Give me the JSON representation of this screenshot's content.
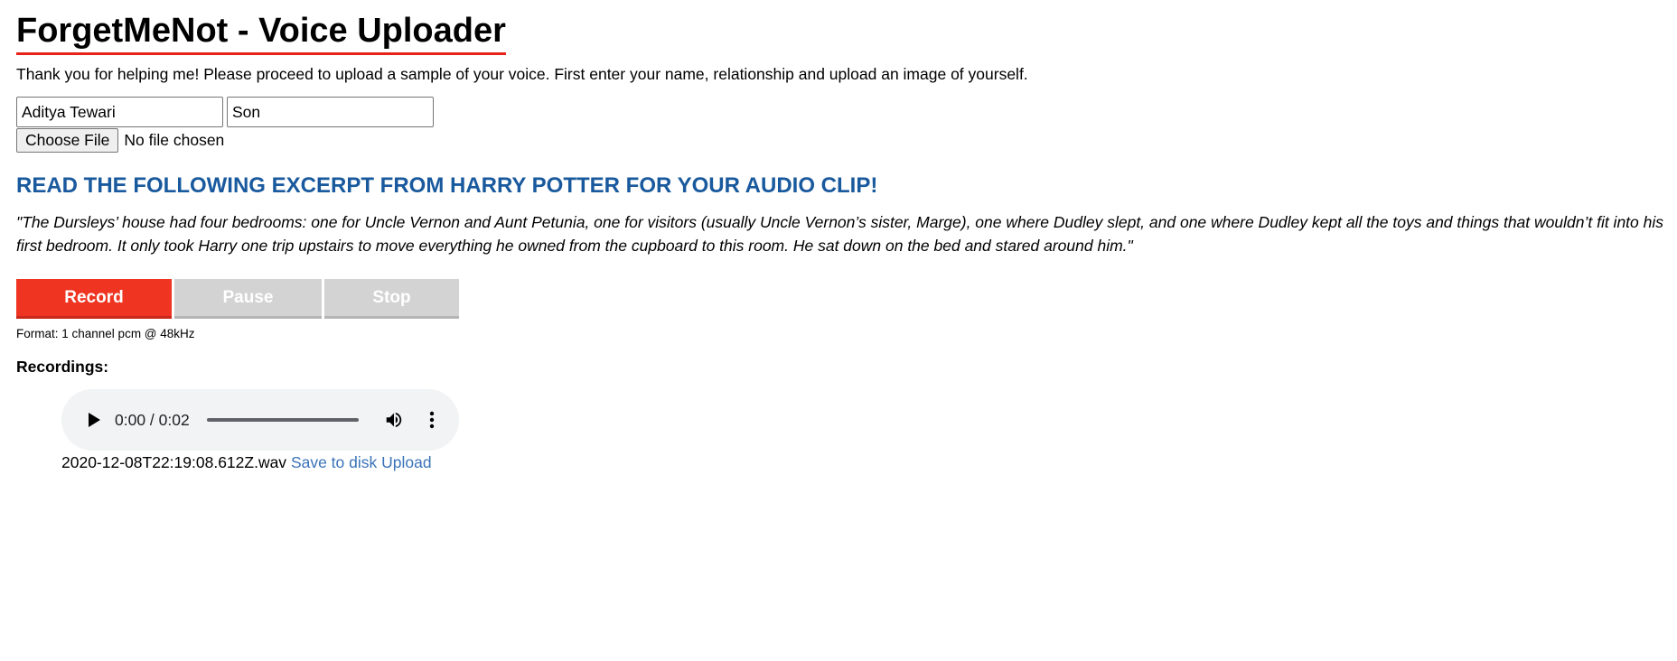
{
  "header": {
    "title": "ForgetMeNot - Voice Uploader"
  },
  "intro_text": "Thank you for helping me! Please proceed to upload a sample of your voice. First enter your name, relationship and upload an image of yourself.",
  "form": {
    "name_value": "Aditya Tewari",
    "relationship_value": "Son",
    "file_button_label": "Choose File",
    "file_status": "No file chosen"
  },
  "excerpt": {
    "heading": "READ THE FOLLOWING EXCERPT FROM HARRY POTTER FOR YOUR AUDIO CLIP!",
    "text": "\"The Dursleys’ house had four bedrooms: one for Uncle Vernon and Aunt Petunia, one for visitors (usually Uncle Vernon’s sister, Marge), one where Dudley slept, and one where Dudley kept all the toys and things that wouldn’t fit into his first bedroom. It only took Harry one trip upstairs to move everything he owned from the cupboard to this room. He sat down on the bed and stared around him.\""
  },
  "controls": {
    "record_label": "Record",
    "pause_label": "Pause",
    "stop_label": "Stop",
    "format_text": "Format: 1 channel pcm @ 48kHz"
  },
  "recordings": {
    "heading": "Recordings:",
    "items": [
      {
        "time_display": "0:00 / 0:02",
        "progress": 0,
        "filename": "2020-12-08T22:19:08.612Z.wav",
        "save_label": "Save to disk",
        "upload_label": "Upload"
      }
    ]
  },
  "colors": {
    "title_underline": "#e8231a",
    "heading_blue": "#19599d",
    "record_red": "#ef3522",
    "disabled_gray": "#d3d3d3",
    "link_blue": "#3a73b8",
    "player_bg": "#f1f3f4"
  },
  "icons": {
    "play": "play-icon",
    "volume": "volume-icon",
    "menu": "more-vertical-icon"
  }
}
